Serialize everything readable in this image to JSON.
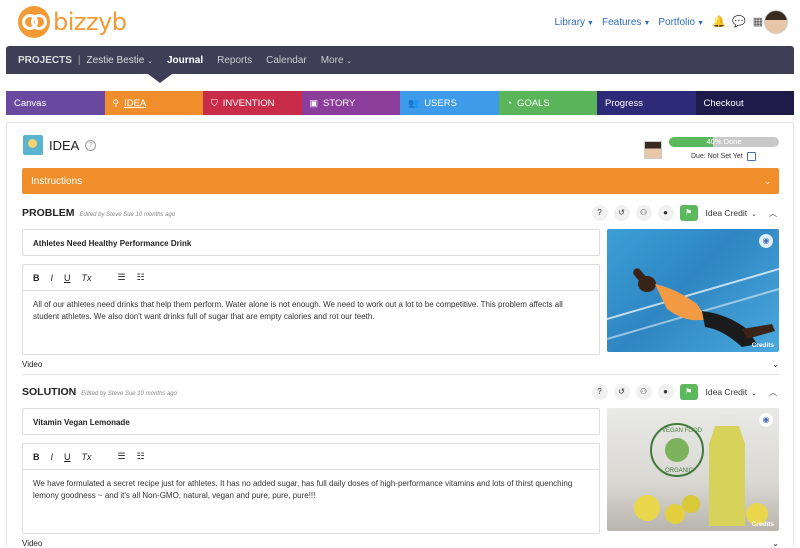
{
  "app": {
    "logo_text": "bizzyb"
  },
  "topnav": {
    "items": [
      "Library",
      "Features",
      "Portfolio"
    ]
  },
  "projbar": {
    "projects_label": "PROJECTS",
    "separator": "|",
    "project_name": "Zestie Bestie",
    "items": [
      "Journal",
      "Reports",
      "Calendar",
      "More"
    ],
    "active": "Journal"
  },
  "tabs": [
    {
      "label": "Canvas",
      "color": "#6a4aa0"
    },
    {
      "label": "IDEA",
      "color": "#f08e2c"
    },
    {
      "label": "INVENTION",
      "color": "#c92c48"
    },
    {
      "label": "STORY",
      "color": "#8b3d9c"
    },
    {
      "label": "USERS",
      "color": "#3d9be9"
    },
    {
      "label": "GOALS",
      "color": "#5ab55a"
    },
    {
      "label": "Progress",
      "color": "#2d2a78"
    },
    {
      "label": "Checkout",
      "color": "#1e1a4a"
    }
  ],
  "idea": {
    "title": "IDEA",
    "progress_text": "40% Done",
    "progress_percent": 40,
    "due_text": "Due: Not Set Yet"
  },
  "instructions": {
    "label": "Instructions"
  },
  "problem": {
    "title": "PROBLEM",
    "edited": "Edited by Steve Sue 10 months ago",
    "credit_label": "Idea Credit",
    "field_title": "Athletes Need Healthy Performance Drink",
    "body": "All of our athletes need drinks that help them perform. Water alone is not enough. We need to work out a lot to be competitive. This problem affects all student athletes. We also don't want drinks full of sugar that are empty calories and rot our teeth.",
    "photo_credits": "Credits",
    "video_label": "Video"
  },
  "solution": {
    "title": "SOLUTION",
    "edited": "Edited by Steve Sue 10 months ago",
    "credit_label": "Idea Credit",
    "field_title": "Vitamin Vegan Lemonade",
    "body": "We have formulated a secret recipe just for athletes. It has no added sugar, has full daily doses of high-performance vitamins and lots of thirst quenching lemony goodness ~ and it's all Non-GMO, natural, vegan and pure, pure, pure!!!",
    "photo_credits": "Credits",
    "video_label": "Video",
    "photo_text_1": "VEGAN FOOD",
    "photo_text_2": "ORGANIC"
  },
  "editor_tools": {
    "bold": "B",
    "italic": "I",
    "underline": "U",
    "clear": "Tx"
  },
  "tools": {
    "help": "?"
  }
}
